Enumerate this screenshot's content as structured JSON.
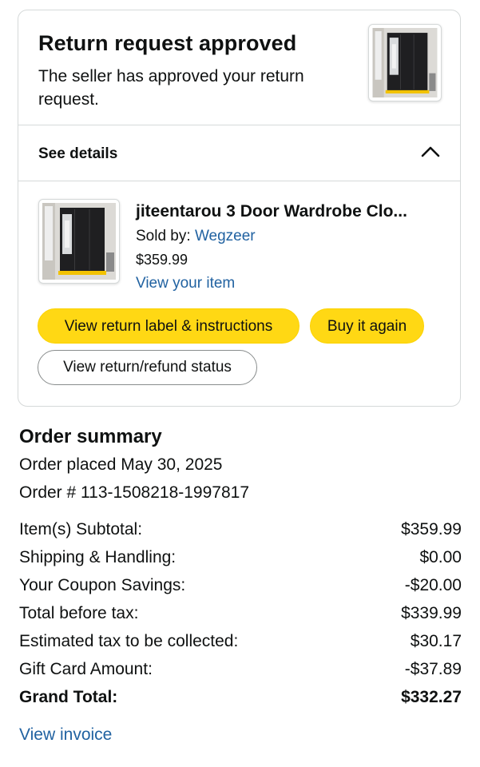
{
  "header": {
    "title": "Return request approved",
    "subtitle": "The seller has approved your return request."
  },
  "details": {
    "label": "See details",
    "toggle_icon": "chevron-up-icon"
  },
  "product": {
    "title": "jiteentarou 3 Door Wardrobe Clo...",
    "sold_by_label": "Sold by: ",
    "seller": "Wegzeer",
    "price": "$359.99",
    "view_item": "View your item",
    "image": "black-wardrobe-thumbnail"
  },
  "actions": {
    "return_label": "View return label & instructions",
    "buy_again": "Buy it again",
    "refund_status": "View return/refund status"
  },
  "summary": {
    "title": "Order summary",
    "order_placed": "Order placed May 30, 2025",
    "order_number": "Order # 113-1508218-1997817",
    "rows": [
      {
        "label": "Item(s) Subtotal:",
        "value": "$359.99"
      },
      {
        "label": "Shipping & Handling:",
        "value": "$0.00"
      },
      {
        "label": "Your Coupon Savings:",
        "value": "-$20.00"
      },
      {
        "label": "Total before tax:",
        "value": "$339.99"
      },
      {
        "label": "Estimated tax to be collected:",
        "value": "$30.17"
      },
      {
        "label": "Gift Card Amount:",
        "value": "-$37.89"
      },
      {
        "label": "Grand Total:",
        "value": "$332.27"
      }
    ],
    "invoice": "View invoice"
  },
  "colors": {
    "button_yellow": "#ffd814",
    "link_blue": "#2162a1",
    "border_gray": "#d5d9d9"
  }
}
